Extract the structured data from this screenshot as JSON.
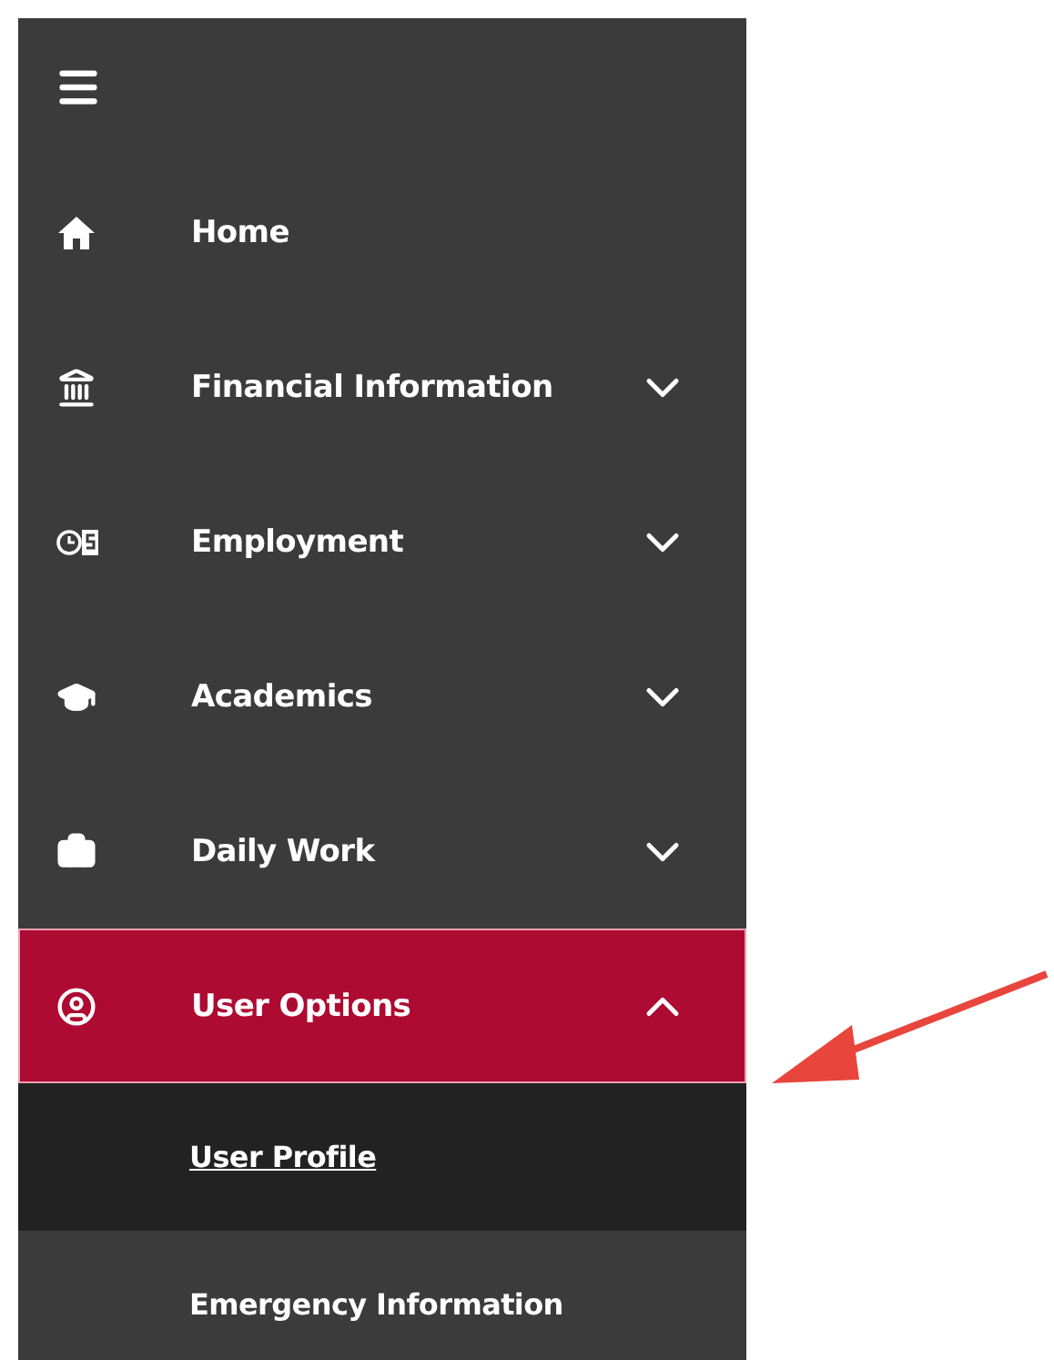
{
  "menu_items": [
    {
      "kind": "home",
      "label": "Home",
      "selected": false
    },
    {
      "kind": "bank",
      "label": "Financial Information",
      "expanded": false,
      "selected": false
    },
    {
      "kind": "clock-dollar",
      "label": "Employment",
      "expanded": false,
      "selected": false
    },
    {
      "kind": "graduation",
      "label": "Academics",
      "expanded": false,
      "selected": false
    },
    {
      "kind": "briefcase",
      "label": "Daily Work",
      "expanded": false,
      "selected": false
    },
    {
      "kind": "user",
      "label": "User Options",
      "expanded": true,
      "selected": true,
      "children": [
        {
          "label": "User Profile",
          "selected": true
        },
        {
          "label": "Emergency Information",
          "selected": false
        }
      ]
    }
  ]
}
